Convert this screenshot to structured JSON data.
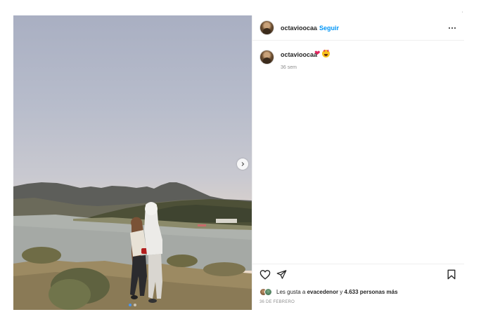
{
  "post": {
    "author": {
      "username": "octavioocaa",
      "separator": "•",
      "follow_label": "Seguir"
    },
    "caption": {
      "username": "octavioocaa",
      "emojis": [
        "heart-icon",
        "star-struck-icon"
      ],
      "time": "36 sem"
    },
    "carousel": {
      "slides": 2,
      "active_slide": 1
    },
    "likes": {
      "prefix": "Les gusta a ",
      "first_user": "evacedenor",
      "connector": " y ",
      "others": "4.633 personas más"
    },
    "date": "36 DE FEBRERO",
    "top_mark": "'"
  },
  "colors": {
    "accent": "#0095f6",
    "text": "#262626",
    "muted": "#8e8e8e",
    "border": "#efefef"
  }
}
